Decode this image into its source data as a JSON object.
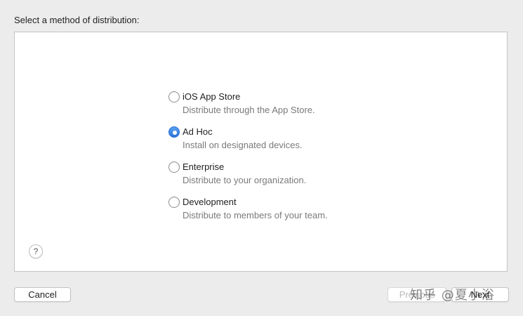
{
  "header": {
    "label": "Select a method of distribution:"
  },
  "options": [
    {
      "title": "iOS App Store",
      "description": "Distribute through the App Store.",
      "selected": false
    },
    {
      "title": "Ad Hoc",
      "description": "Install on designated devices.",
      "selected": true
    },
    {
      "title": "Enterprise",
      "description": "Distribute to your organization.",
      "selected": false
    },
    {
      "title": "Development",
      "description": "Distribute to members of your team.",
      "selected": false
    }
  ],
  "help": {
    "label": "?"
  },
  "footer": {
    "cancel_label": "Cancel",
    "previous_label": "Previous",
    "next_label": "Next"
  },
  "watermark": {
    "text": "知乎 @夏小浴"
  },
  "colors": {
    "accent": "#2b73d8",
    "background": "#ececec",
    "panel": "#ffffff"
  }
}
